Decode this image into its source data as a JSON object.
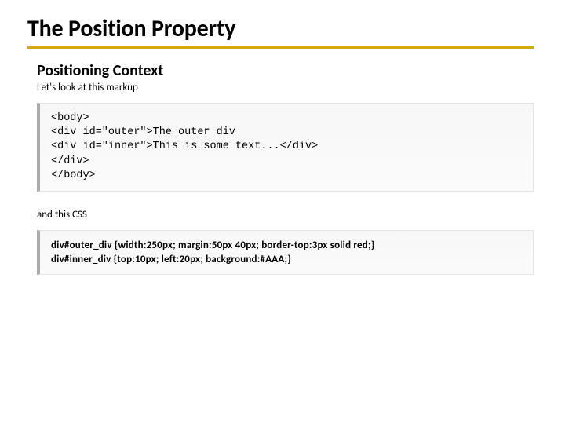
{
  "title": "The Position Property",
  "subtitle": "Positioning Context",
  "intro": "Let's look at this markup",
  "code_html": "<body>\n<div id=\"outer\">The outer div\n<div id=\"inner\">This is some text...</div>\n</div>\n</body>",
  "mid": "and this CSS",
  "code_css": "div#outer_div {width:250px; margin:50px 40px; border-top:3px solid red;}\ndiv#inner_div {top:10px; left:20px; background:#AAA;}"
}
